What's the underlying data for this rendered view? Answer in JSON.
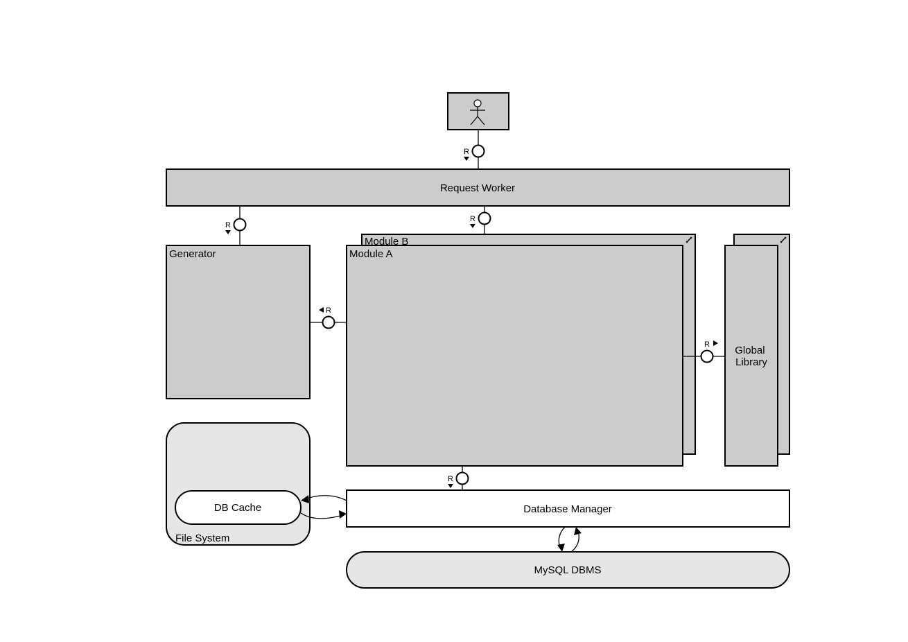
{
  "components": {
    "request_worker": "Request Worker",
    "generator": "Generator",
    "module_a": "Module A",
    "module_b": "Module B",
    "global_library": [
      "Global",
      "Library"
    ],
    "file_system": "File System",
    "db_cache": "DB Cache",
    "database_manager": "Database Manager",
    "mysql_dbms": "MySQL DBMS"
  },
  "interfaces": {
    "actor_to_worker": "R",
    "worker_to_generator": "R",
    "worker_to_modules": "R",
    "module_to_generator": "R",
    "module_to_library": "R",
    "module_to_db": "R"
  },
  "icons": {
    "actor": "stick-figure-icon",
    "multi_instance": "multi-instance-icon",
    "provided_interface": "lollipop-icon",
    "direction": "triangle-arrow-icon"
  },
  "colors": {
    "component_fill": "#cccccc",
    "container_fill": "#e6e6e6",
    "plain_fill": "#ffffff",
    "stroke": "#000000"
  }
}
